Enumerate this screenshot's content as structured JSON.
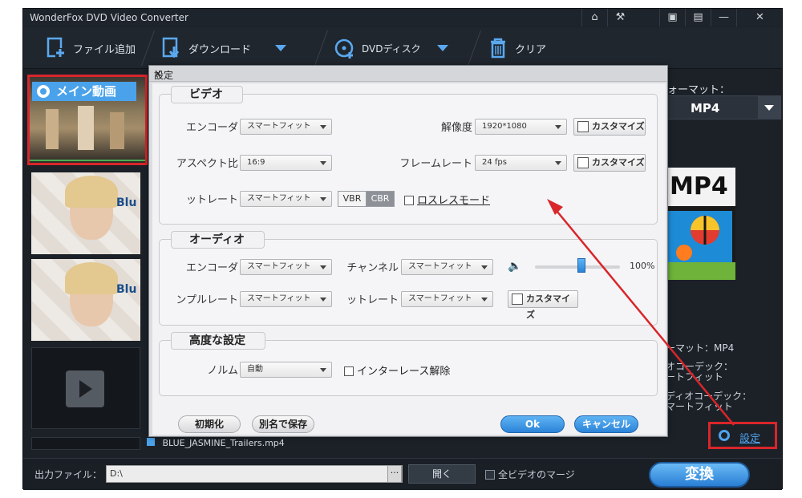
{
  "window": {
    "title": "WonderFox DVD Video Converter"
  },
  "toolbar": {
    "add_file": "ファイル追加",
    "download": "ダウンロード",
    "dvd_disc": "DVDディスク",
    "clear": "クリア"
  },
  "left": {
    "main_video_label": "メイン動画",
    "file_name": "BLUE_JASMINE_Trailers.mp4"
  },
  "right": {
    "format_label": "ォーマット：",
    "format_value": "MP4",
    "logo_text": "MP4",
    "info_format": "ーマット：MP4",
    "info_video_codec": "オコーデック：\nートフィット",
    "info_audio_codec": "ディオコーデック：\nマートフィット",
    "settings_link": "設定"
  },
  "bottom": {
    "output_label": "出力ファイル：",
    "output_path": "D:\\",
    "browse": "···",
    "open_button": "開く",
    "merge_label": "全ビデオのマージ",
    "convert_button": "変換"
  },
  "dialog": {
    "title": "設定",
    "video": {
      "group_title": "ビデオ",
      "encoder_label": "エンコーダ",
      "encoder_value": "スマートフィット",
      "resolution_label": "解像度",
      "resolution_value": "1920*1080",
      "custom1": "カスタマイズ",
      "aspect_label": "アスペクト比",
      "aspect_value": "16:9",
      "framerate_label": "フレームレート",
      "framerate_value": "24 fps",
      "custom2": "カスタマイズ",
      "bitrate_label": "ットレート",
      "bitrate_value": "スマートフィット",
      "vbr": "VBR",
      "cbr": "CBR",
      "lossless": "ロスレスモード"
    },
    "audio": {
      "group_title": "オーディオ",
      "encoder_label": "エンコーダ",
      "encoder_value": "スマートフィット",
      "channel_label": "チャンネル",
      "channel_value": "スマートフィット",
      "volume": "100%",
      "volume_level": 0.55,
      "samplerate_label": "ンプルレート",
      "samplerate_value": "スマートフィット",
      "bitrate_label": "ットレート",
      "bitrate_value": "スマートフィット",
      "custom": "カスタマイズ"
    },
    "advanced": {
      "group_title": "高度な設定",
      "norm_label": "ノルム",
      "norm_value": "自動",
      "deinterlace": "インターレース解除"
    },
    "reset_button": "初期化",
    "save_as_button": "別名で保存",
    "ok_button": "Ok",
    "cancel_button": "キャンセル"
  },
  "colors": {
    "accent": "#4aa2ea",
    "highlight_red": "#d8262a",
    "window_bg": "#1c2128"
  }
}
